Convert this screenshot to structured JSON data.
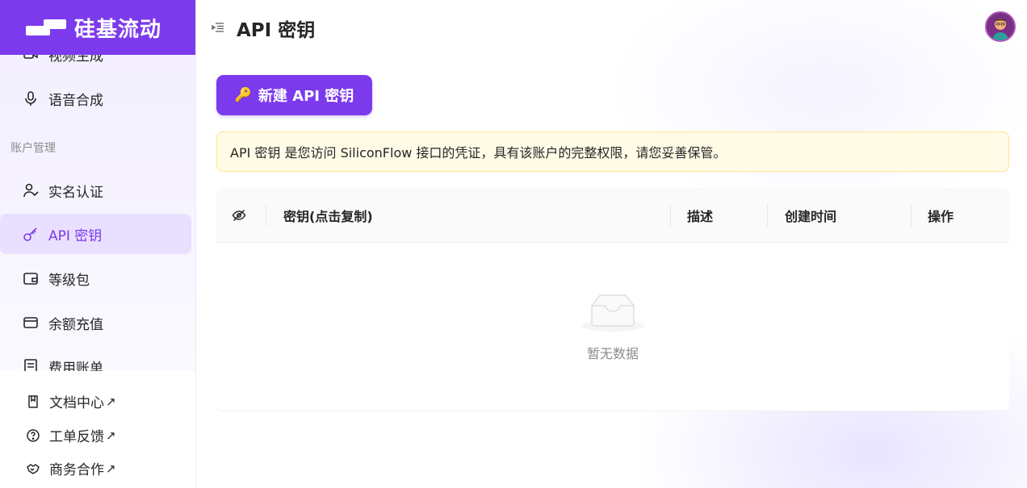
{
  "brand": {
    "name": "硅基流动"
  },
  "header": {
    "title": "API 密钥"
  },
  "sidebar": {
    "items": [
      {
        "label": "视频生成",
        "icon": "video-icon"
      },
      {
        "label": "语音合成",
        "icon": "microphone-icon"
      }
    ],
    "section_label": "账户管理",
    "account_items": [
      {
        "label": "实名认证",
        "icon": "user-check-icon"
      },
      {
        "label": "API 密钥",
        "icon": "key-icon",
        "active": true
      },
      {
        "label": "等级包",
        "icon": "wallet-icon"
      },
      {
        "label": "余额充值",
        "icon": "credit-card-icon"
      },
      {
        "label": "费用账单",
        "icon": "receipt-icon"
      }
    ],
    "bottom_links": [
      {
        "label": "文档中心",
        "icon": "book-icon",
        "arrow": "↗"
      },
      {
        "label": "工单反馈",
        "icon": "help-circle-icon",
        "arrow": "↗"
      },
      {
        "label": "商务合作",
        "icon": "handshake-icon",
        "arrow": "↗"
      }
    ]
  },
  "actions": {
    "create_label": "新建 API 密钥",
    "create_emoji": "🔑"
  },
  "notice": {
    "text": "API 密钥 是您访问 SiliconFlow 接口的凭证，具有该账户的完整权限，请您妥善保管。"
  },
  "table": {
    "columns": [
      "密钥(点击复制)",
      "描述",
      "创建时间",
      "操作"
    ],
    "empty_text": "暂无数据"
  },
  "colors": {
    "accent": "#7c3aed",
    "notice_bg": "#fffbe6",
    "notice_border": "#ffe58f"
  }
}
